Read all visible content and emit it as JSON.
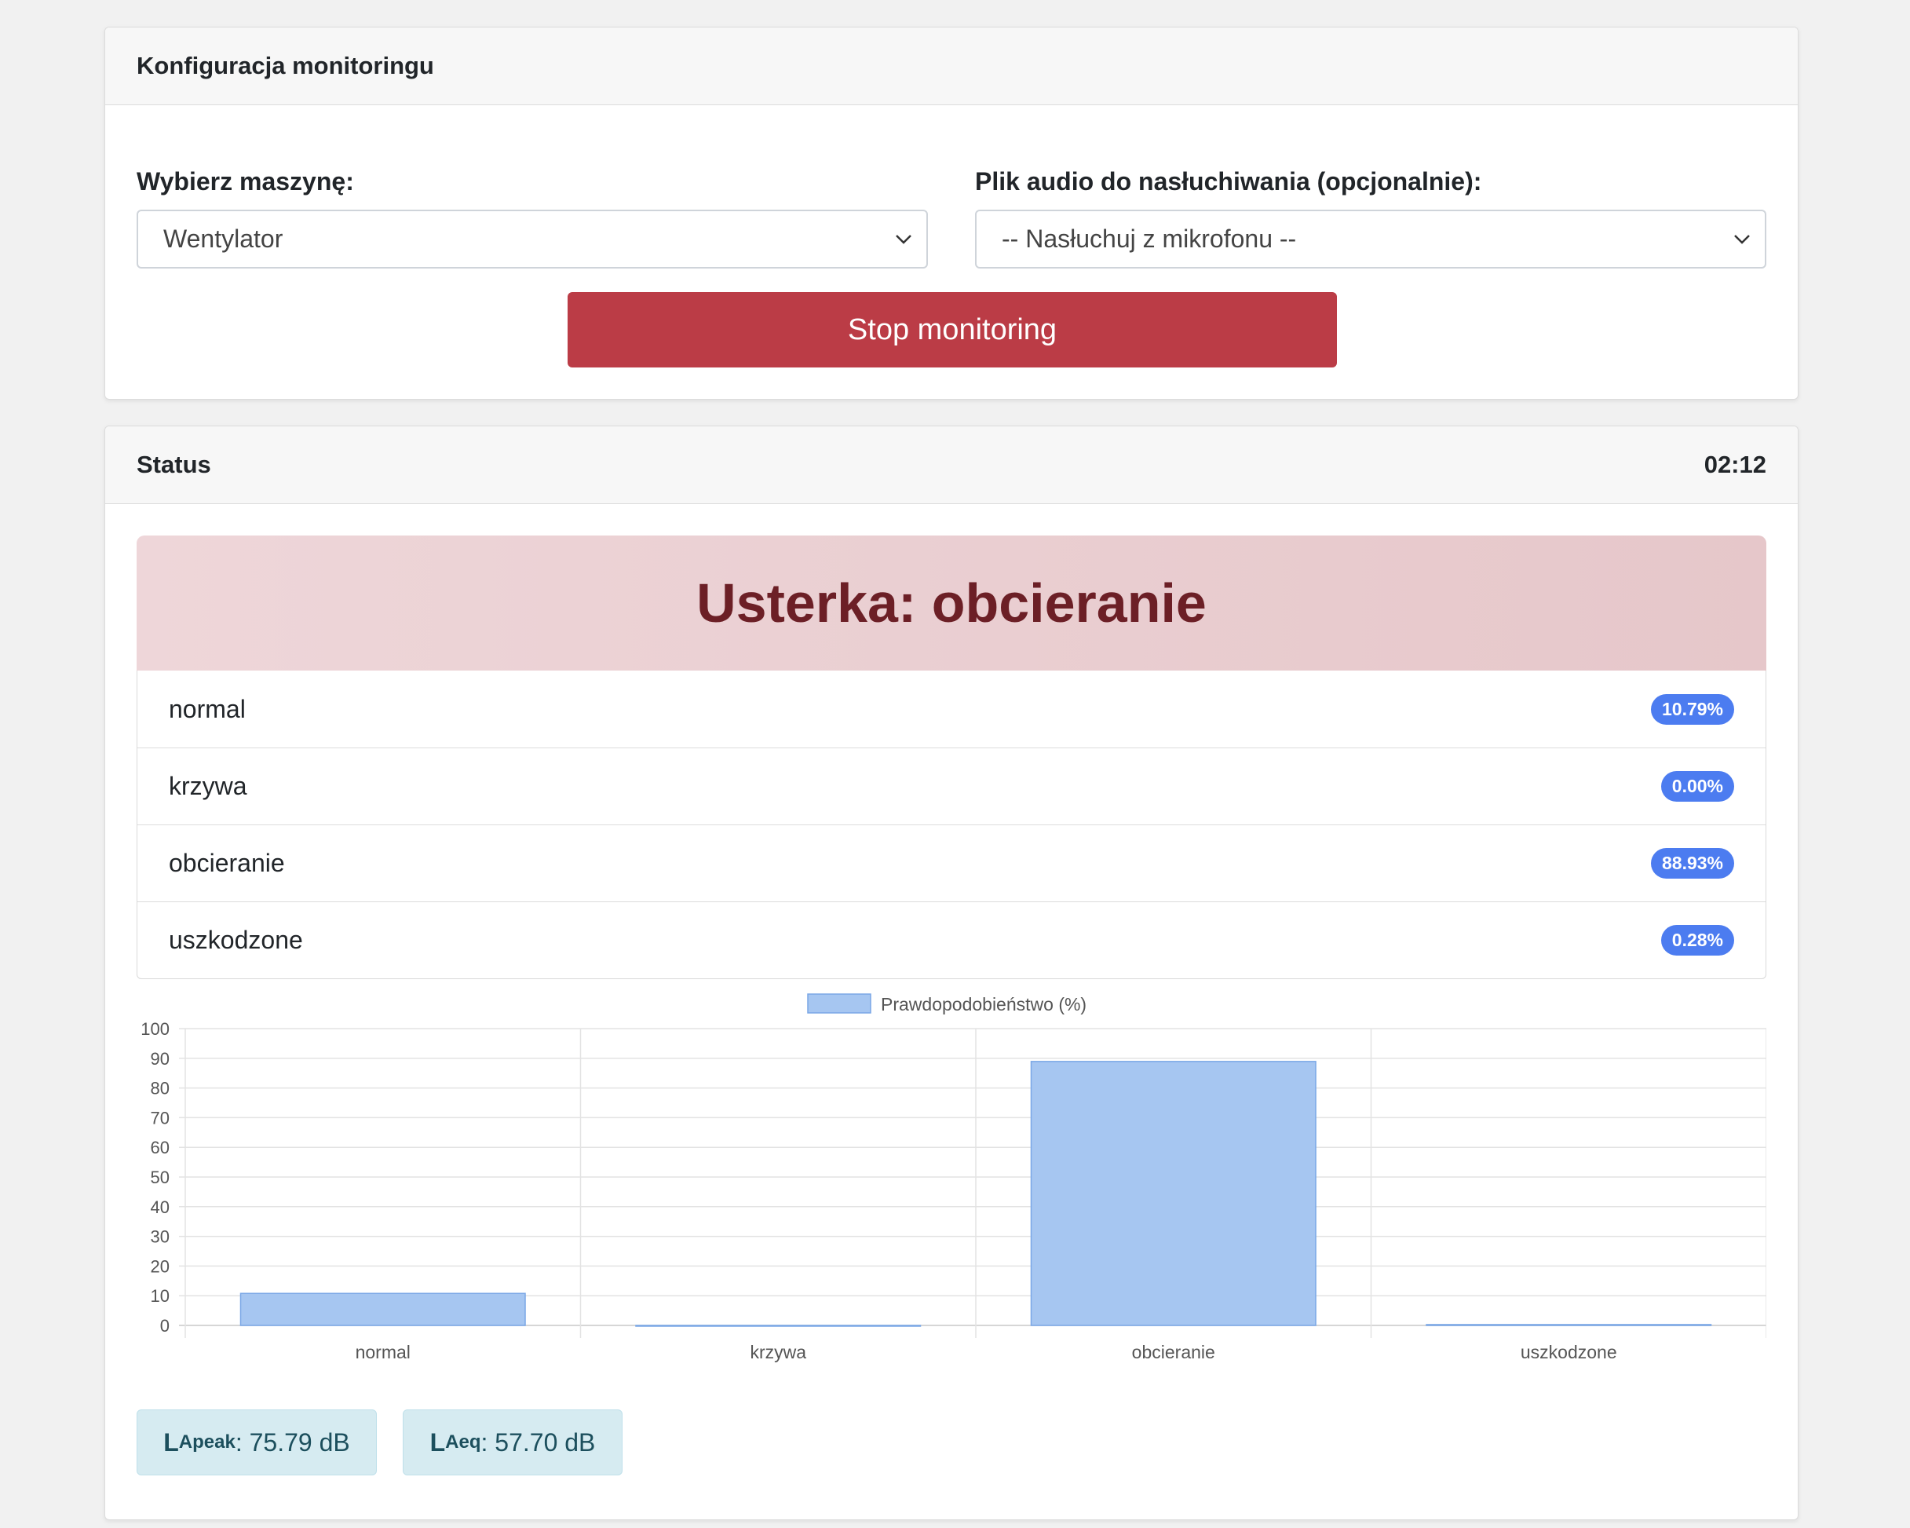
{
  "config": {
    "title": "Konfiguracja monitoringu",
    "machine_label": "Wybierz maszynę:",
    "machine_value": "Wentylator",
    "audio_label": "Plik audio do nasłuchiwania (opcjonalnie):",
    "audio_value": "-- Nasłuchuj z mikrofonu --",
    "stop_label": "Stop monitoring"
  },
  "status": {
    "title": "Status",
    "time": "02:12",
    "alert": "Usterka: obcieranie",
    "classes": [
      {
        "label": "normal",
        "percent": "10.79%"
      },
      {
        "label": "krzywa",
        "percent": "0.00%"
      },
      {
        "label": "obcieranie",
        "percent": "88.93%"
      },
      {
        "label": "uszkodzone",
        "percent": "0.28%"
      }
    ]
  },
  "metrics": {
    "lapeak_sub": "Apeak",
    "lapeak_value": ": 75.79 dB",
    "laeq_sub": "Aeq",
    "laeq_value": ": 57.70 dB",
    "l": "L"
  },
  "colors": {
    "bar_fill": "#a6c6f1",
    "bar_stroke": "#7aa7e6",
    "badge": "#4c7cf0",
    "stop": "#bb3c46"
  },
  "chart_data": {
    "type": "bar",
    "categories": [
      "normal",
      "krzywa",
      "obcieranie",
      "uszkodzone"
    ],
    "series": [
      {
        "name": "Prawdopodobieństwo (%)",
        "values": [
          10.79,
          0.0,
          88.93,
          0.28
        ]
      }
    ],
    "ylim": [
      0,
      100
    ],
    "yticks": [
      0,
      10,
      20,
      30,
      40,
      50,
      60,
      70,
      80,
      90,
      100
    ],
    "legend": "top-center",
    "grid": true
  }
}
